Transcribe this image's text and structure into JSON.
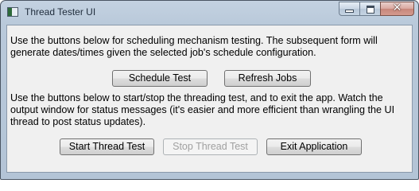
{
  "window": {
    "title": "Thread Tester UI",
    "icons": {
      "app": "app-window-icon",
      "minimize": "minimize-icon",
      "maximize": "maximize-icon",
      "close": "close-icon"
    },
    "close_glyph": "✕"
  },
  "content": {
    "scheduling_description": "Use the buttons below for scheduling mechanism testing. The subsequent form will generate dates/times given the selected job's schedule configuration.",
    "threading_description": "Use the buttons below to start/stop the threading test, and to exit the app. Watch the output window for status messages (it's easier and more efficient than wrangling the UI thread to post status updates)."
  },
  "buttons": {
    "schedule_test": "Schedule Test",
    "refresh_jobs": "Refresh Jobs",
    "start_thread_test": "Start Thread Test",
    "stop_thread_test": "Stop Thread Test",
    "exit_application": "Exit Application"
  },
  "state": {
    "stop_thread_test_enabled": false
  }
}
